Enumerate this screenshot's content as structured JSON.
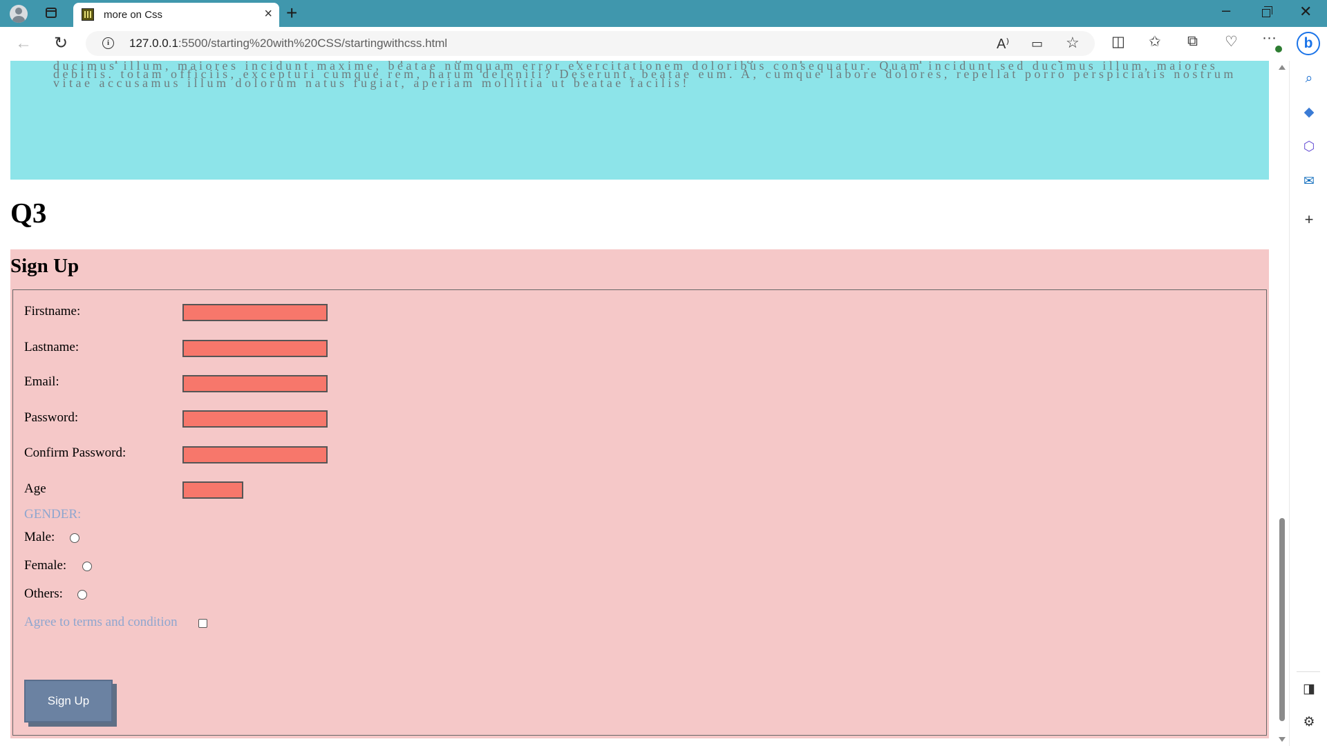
{
  "browser": {
    "tab_title": "more on Css",
    "url_host": "127.0.0.1",
    "url_path": ":5500/starting%20with%20CSS/startingwithcss.html"
  },
  "page": {
    "lorem_text": "Lorem ipsum dolor sit amet consectetur adipisicing elit. Iste temporibus distinctio eligendi quibusdam cumque dolorum sit. Quas incidunt sed ducimus illum, maiores incidunt maxime, beatae numquam error exercitationem doloribus consequatur. Quam incidunt sed ducimus illum, maiores debitis. totam officiis, excepturi cumque rem, harum deleniti? Deserunt, beatae eum. A, cumque labore dolores, repellat porro perspiciatis nostrum vitae accusamus illum dolorum natus fugiat, aperiam mollitia ut beatae facilis!",
    "q3_heading": "Q3",
    "signup_title": "Sign Up",
    "form": {
      "firstname_label": "Firstname:",
      "lastname_label": "Lastname:",
      "email_label": "Email:",
      "password_label": "Password:",
      "confirm_password_label": "Confirm Password:",
      "age_label": "Age",
      "gender_label": "GENDER:",
      "male_label": "Male:",
      "female_label": "Female:",
      "others_label": "Others:",
      "terms_label": "Agree to terms and condition",
      "submit_label": "Sign Up"
    }
  },
  "colors": {
    "titlebar": "#4097ad",
    "cyan_box": "#8de4e9",
    "form_bg": "#f5c8c8",
    "input_bg": "#f7776b",
    "button_bg": "#6b82a2",
    "gender_label": "#8ea6cf"
  },
  "icons": {
    "reading_aloud": "A⁾",
    "favorite": "☆",
    "split": "▯",
    "favorites": "☆≡",
    "collections": "⧉",
    "more": "···",
    "bing": "b"
  }
}
